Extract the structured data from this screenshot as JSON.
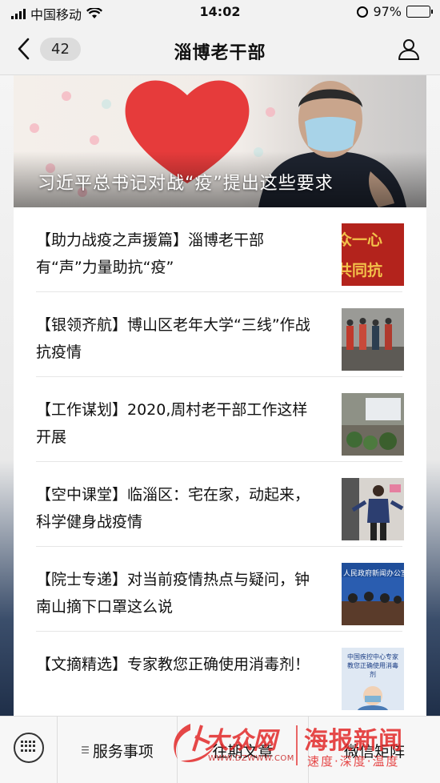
{
  "status_bar": {
    "carrier": "中国移动",
    "time": "14:02",
    "battery_percent": "97%",
    "battery_level": 0.97,
    "battery_color": "#3cc14b"
  },
  "nav": {
    "back_count": "42",
    "title": "淄博老干部"
  },
  "hero": {
    "title": "习近平总书记对战“疫”提出这些要求"
  },
  "articles": [
    {
      "title": "【助力战疫之声援篇】淄博老干部有“声”力量助抗“疫”",
      "thumb_text": "众一心 共同抗"
    },
    {
      "title": "【银领齐航】博山区老年大学“三线”作战抗疫情"
    },
    {
      "title": "【工作谋划】2020,周村老干部工作这样开展"
    },
    {
      "title": "【空中课堂】临淄区：宅在家，动起来，科学健身战疫情"
    },
    {
      "title": "【院士专递】对当前疫情热点与疑问，钟南山摘下口罩这么说",
      "thumb_text": "人民政府新闻办公室"
    },
    {
      "title": "【文摘精选】专家教您正确使用消毒剂！",
      "thumb_text": "中国疾控中心专家教您正确使用消毒剂"
    }
  ],
  "menu": {
    "item1": "服务事项",
    "item2": "往期文章",
    "item3": "微信矩阵"
  },
  "watermark": {
    "brand1": "大众网",
    "url": "WWW.DZWWW.COM",
    "brand2": "海报新闻",
    "slogan": "速度·深度·温度"
  },
  "colors": {
    "heart": "#e63b3b",
    "watermark_red": "#e22828"
  }
}
